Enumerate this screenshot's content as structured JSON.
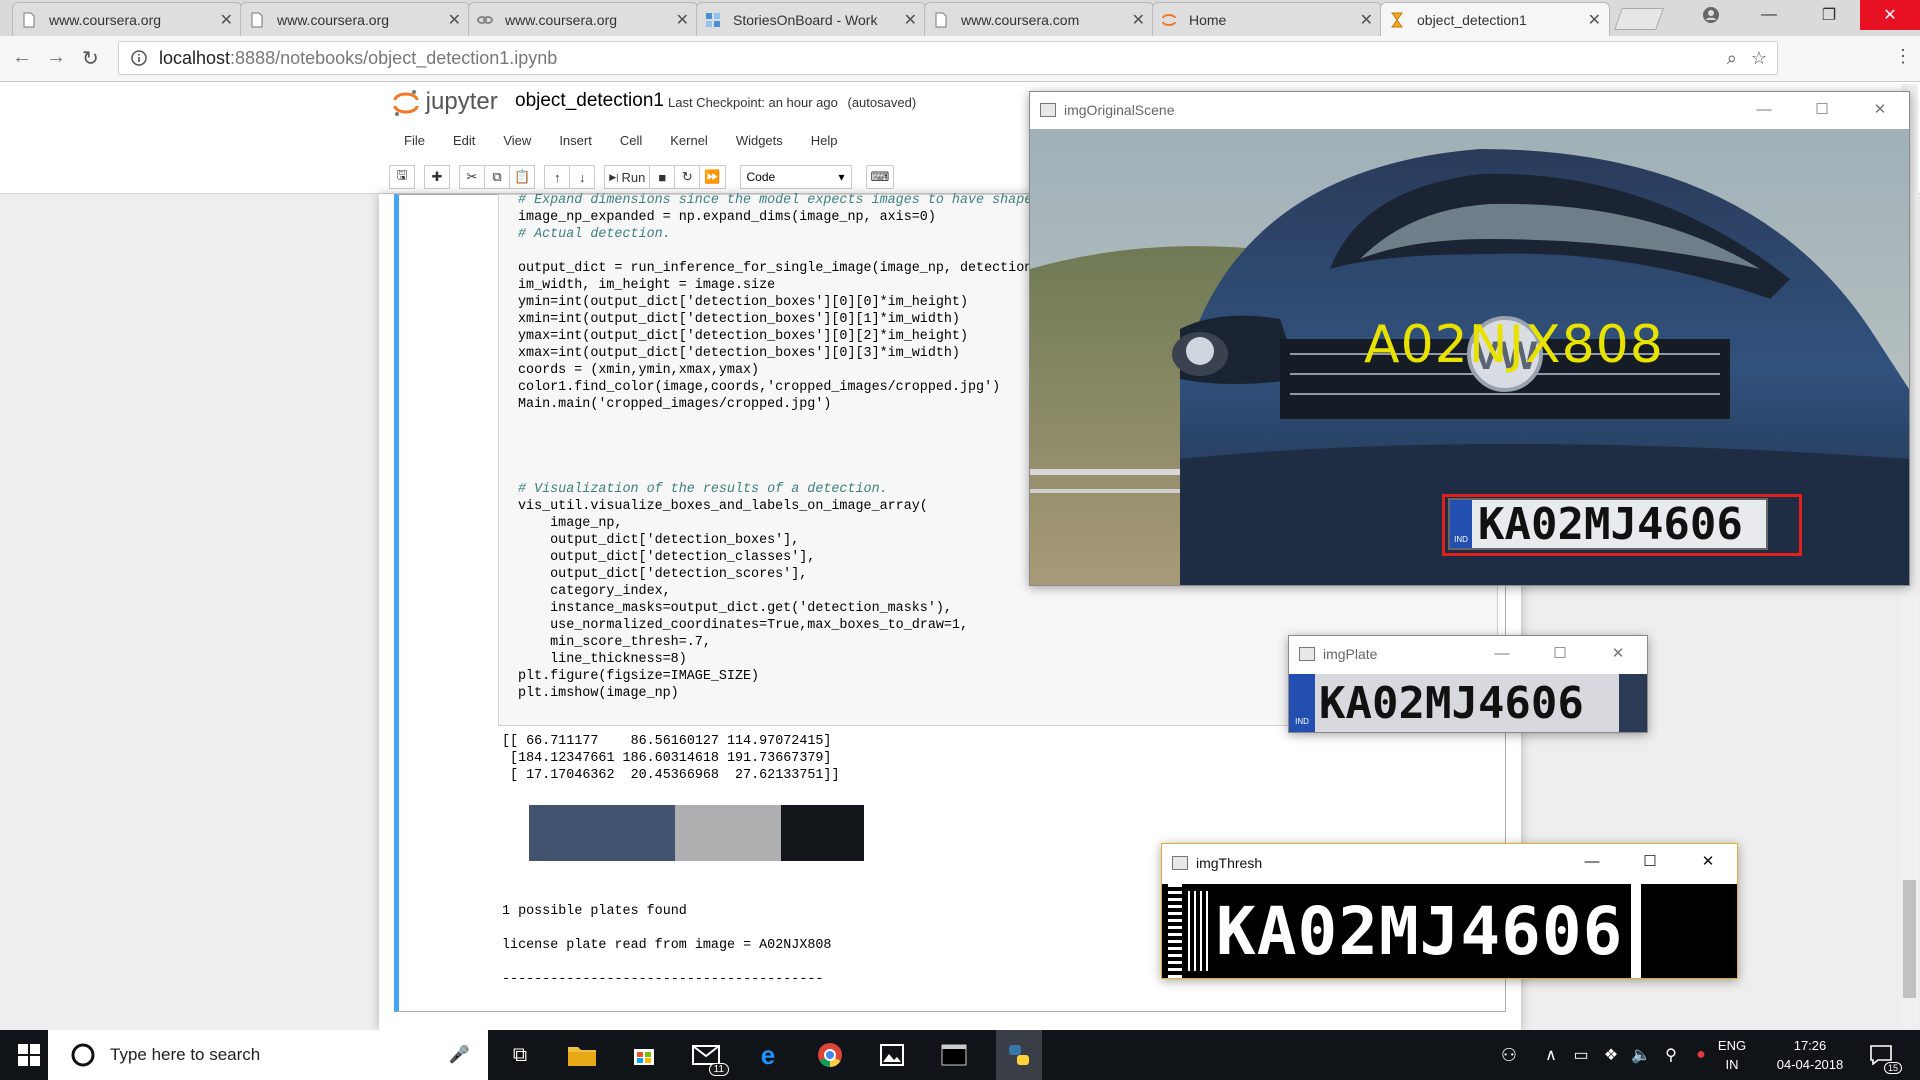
{
  "browser": {
    "tabs": [
      {
        "title": "www.coursera.org",
        "icon": "page-icon"
      },
      {
        "title": "www.coursera.org",
        "icon": "page-icon"
      },
      {
        "title": "www.coursera.org",
        "icon": "link-icon"
      },
      {
        "title": "StoriesOnBoard - Work",
        "icon": "storiesonboard-icon"
      },
      {
        "title": "www.coursera.com",
        "icon": "page-icon"
      },
      {
        "title": "Home",
        "icon": "jupyter-icon"
      },
      {
        "title": "object_detection1",
        "icon": "hourglass-icon"
      }
    ],
    "url_host": "localhost",
    "url_path": ":8888/notebooks/object_detection1.ipynb"
  },
  "jupyter": {
    "logo_text": "jupyter",
    "notebook_name": "object_detection1",
    "checkpoint_label": "Last Checkpoint:",
    "checkpoint_time": "an hour ago",
    "autosave_status": "(autosaved)",
    "menu": [
      "File",
      "Edit",
      "View",
      "Insert",
      "Cell",
      "Kernel",
      "Widgets",
      "Help"
    ],
    "toolbar": {
      "run_label": "Run",
      "cell_type": "Code"
    }
  },
  "code_lines": [
    "# Expand dimensions since the model expects images to have shape: [",
    "image_np_expanded = np.expand_dims(image_np, axis=0)",
    "# Actual detection.",
    "",
    "output_dict = run_inference_for_single_image(image_np, detection_gr",
    "im_width, im_height = image.size",
    "ymin=int(output_dict['detection_boxes'][0][0]*im_height)",
    "xmin=int(output_dict['detection_boxes'][0][1]*im_width)",
    "ymax=int(output_dict['detection_boxes'][0][2]*im_height)",
    "xmax=int(output_dict['detection_boxes'][0][3]*im_width)",
    "coords = (xmin,ymin,xmax,ymax)",
    "color1.find_color(image,coords,'cropped_images/cropped.jpg')",
    "Main.main('cropped_images/cropped.jpg')",
    "",
    "",
    "",
    "",
    "# Visualization of the results of a detection.",
    "vis_util.visualize_boxes_and_labels_on_image_array(",
    "    image_np,",
    "    output_dict['detection_boxes'],",
    "    output_dict['detection_classes'],",
    "    output_dict['detection_scores'],",
    "    category_index,",
    "    instance_masks=output_dict.get('detection_masks'),",
    "    use_normalized_coordinates=True,max_boxes_to_draw=1,",
    "    min_score_thresh=.7,",
    "    line_thickness=8)",
    "plt.figure(figsize=IMAGE_SIZE)",
    "plt.imshow(image_np)"
  ],
  "output_lines": [
    "[[ 66.711177    86.56160127 114.97072415]",
    " [184.12347661 186.60314618 191.73667379]",
    " [ 17.17046362  20.45366968  27.62133751]]",
    "",
    "",
    "",
    "",
    "",
    "",
    "",
    "1 possible plates found",
    "",
    "license plate read from image = A02NJX808",
    "",
    "----------------------------------------"
  ],
  "color_swatches": [
    "#425370",
    "#afafb2",
    "#12161b"
  ],
  "cv_windows": {
    "original_scene": {
      "title": "imgOriginalScene",
      "overlay_text": "A02NJX808",
      "plate_text": "KA02MJ4606",
      "plate_badge": "IND"
    },
    "plate": {
      "title": "imgPlate",
      "plate_text": "KA02MJ4606",
      "plate_badge": "IND"
    },
    "thresh": {
      "title": "imgThresh",
      "plate_text": "KA02MJ4606"
    }
  },
  "taskbar": {
    "search_placeholder": "Type here to search",
    "mail_badge": "11",
    "lang_line1": "ENG",
    "lang_line2": "IN",
    "time": "17:26",
    "date": "04-04-2018",
    "notification_count": "15"
  }
}
